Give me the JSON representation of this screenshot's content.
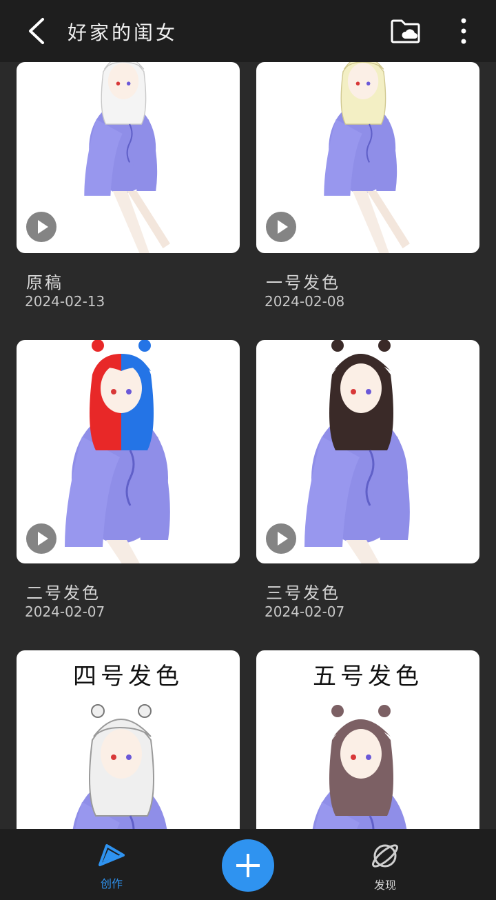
{
  "header": {
    "title": "好家的闺女",
    "back_icon": "chevron-left-icon",
    "folder_icon": "cloud-folder-icon",
    "more_icon": "more-vertical-icon"
  },
  "artworks": [
    {
      "title": "原稿",
      "date": "2024-02-13",
      "hair": "#f4f4f4"
    },
    {
      "title": "一号发色",
      "date": "2024-02-08",
      "hair": "#f3efc4"
    },
    {
      "title": "二号发色",
      "date": "2024-02-07",
      "hair": "split-red-blue"
    },
    {
      "title": "三号发色",
      "date": "2024-02-07",
      "hair": "#3a2a28"
    },
    {
      "title": "",
      "date": "",
      "overlay": "四号发色",
      "hair": "#efefef"
    },
    {
      "title": "",
      "date": "",
      "overlay": "五号发色",
      "hair": "#7c6064"
    }
  ],
  "bottom_nav": {
    "create_label": "创作",
    "discover_label": "发现",
    "active_color": "#2f93f0",
    "add_icon": "plus-icon"
  }
}
